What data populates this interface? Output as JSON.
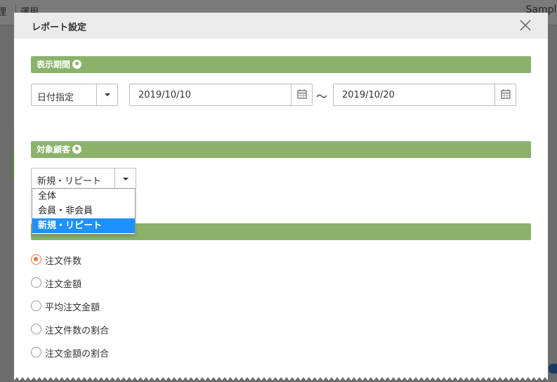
{
  "background": {
    "nav_item_a": "理",
    "nav_item_b": "運用",
    "sample_text": "Sample"
  },
  "modal": {
    "title": "レポート設定",
    "close_icon": "close-icon"
  },
  "period_section": {
    "label": "表示期間",
    "info_icon": "lightbulb-icon",
    "mode_select": "日付指定",
    "date_from": "2019/10/10",
    "date_to": "2019/10/20",
    "separator": "～"
  },
  "target_section": {
    "label": "対象顧客",
    "info_icon": "lightbulb-icon",
    "selected": "新規・リピート",
    "options": [
      "全体",
      "会員・非会員",
      "新規・リピート"
    ]
  },
  "graph_section": {
    "radios": [
      {
        "label": "注文件数",
        "checked": true
      },
      {
        "label": "注文金額",
        "checked": false
      },
      {
        "label": "平均注文金額",
        "checked": false
      },
      {
        "label": "注文件数の割合",
        "checked": false
      },
      {
        "label": "注文金額の割合",
        "checked": false
      }
    ]
  },
  "colors": {
    "section_bar": "#8ab26b",
    "radio_checked": "#e8743b",
    "option_selected": "#1e90ff"
  }
}
